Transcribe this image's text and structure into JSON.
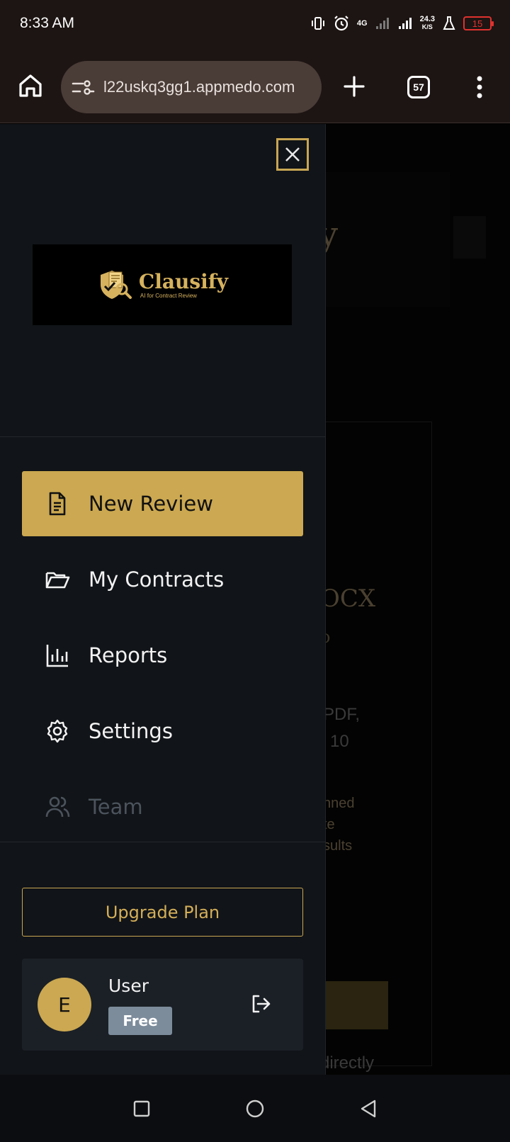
{
  "status_bar": {
    "time": "8:33 AM",
    "network": "4G",
    "speed_value": "24.3",
    "speed_unit": "K/S",
    "battery": "15"
  },
  "browser": {
    "url": "l22uskq3gg1.appmedo.com",
    "tab_count": "57"
  },
  "background_page": {
    "ghost_texts": [
      "y",
      "OCX",
      "o",
      "PDF,",
      "10",
      "nned",
      "te",
      "sults",
      "directly"
    ]
  },
  "drawer": {
    "logo": {
      "name": "Clausify",
      "tagline": "AI for Contract Review"
    },
    "nav_items": [
      {
        "label": "New Review",
        "icon": "file-text-icon",
        "active": true
      },
      {
        "label": "My Contracts",
        "icon": "folder-open-icon",
        "active": false
      },
      {
        "label": "Reports",
        "icon": "bar-chart-icon",
        "active": false
      },
      {
        "label": "Settings",
        "icon": "gear-icon",
        "active": false
      },
      {
        "label": "Team",
        "icon": "users-icon",
        "active": false,
        "disabled": true
      }
    ],
    "upgrade_label": "Upgrade Plan",
    "user": {
      "avatar_initial": "E",
      "name": "User",
      "plan": "Free"
    }
  },
  "colors": {
    "accent": "#cba851",
    "drawer_bg": "#111418",
    "browser_bar": "#1d1513"
  }
}
